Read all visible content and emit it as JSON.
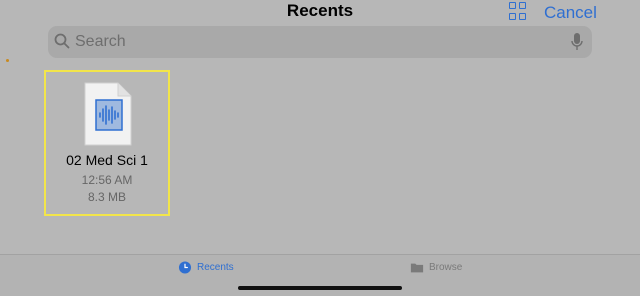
{
  "header": {
    "title": "Recents",
    "cancel_label": "Cancel",
    "grid_icon": "grid-view-icon"
  },
  "search": {
    "placeholder": "Search",
    "icons": [
      "search-icon",
      "microphone-icon"
    ]
  },
  "files": [
    {
      "name": "02 Med Sci 1",
      "time": "12:56 AM",
      "size": "8.3 MB",
      "icon": "audio-file-icon",
      "selected": true
    }
  ],
  "tabbar": {
    "recents_label": "Recents",
    "browse_label": "Browse",
    "active": "Recents"
  },
  "colors": {
    "accent": "#2f6fd1",
    "selection_border": "#f2e54a",
    "background": "#b7b7b7"
  }
}
